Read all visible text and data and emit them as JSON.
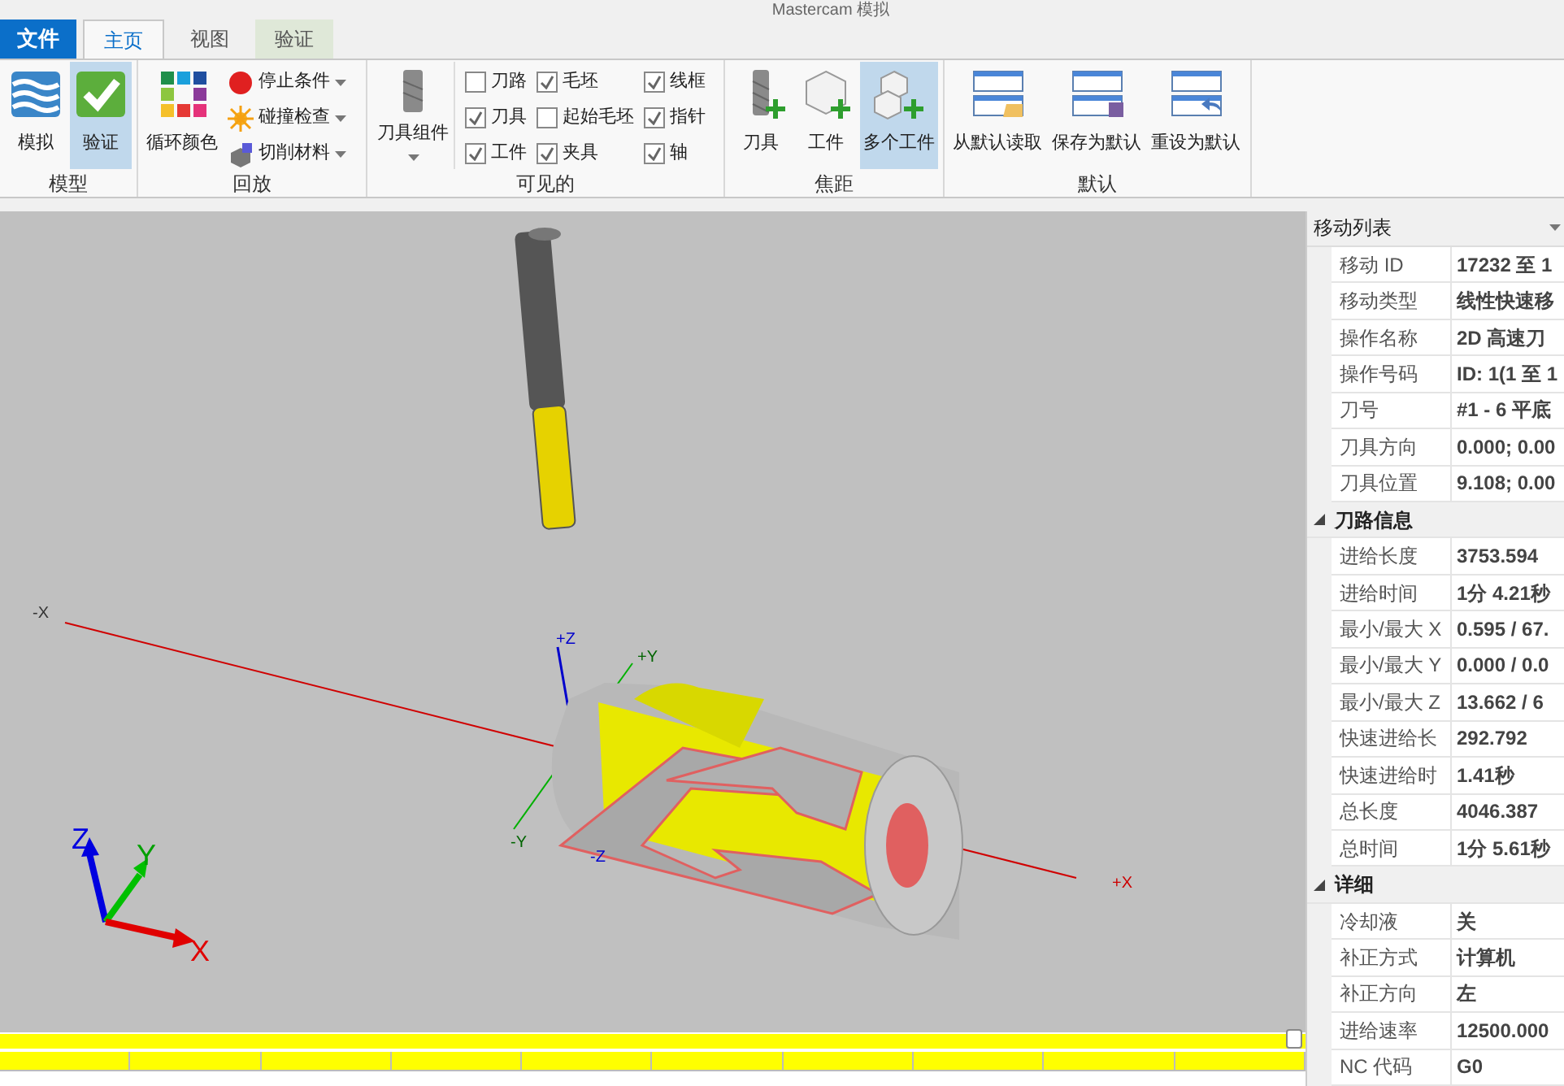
{
  "window": {
    "title": "Mastercam 模拟"
  },
  "file_tab": "文件",
  "tabs": [
    {
      "label": "主页",
      "selected": true,
      "kind": "normal"
    },
    {
      "label": "视图",
      "selected": false,
      "kind": "normal"
    },
    {
      "label": "验证",
      "selected": false,
      "kind": "context"
    }
  ],
  "ribbon_groups": [
    {
      "label": "模型",
      "items": [
        {
          "kind": "large",
          "label": "模拟",
          "selected": false
        },
        {
          "kind": "large",
          "label": "验证",
          "selected": true
        }
      ]
    },
    {
      "label": "回放",
      "items": [
        {
          "kind": "large",
          "label": "循环颜色",
          "selected": false
        },
        {
          "kind": "small",
          "label": "停止条件"
        },
        {
          "kind": "small",
          "label": "碰撞检查"
        },
        {
          "kind": "small",
          "label": "切削材料"
        }
      ]
    },
    {
      "label": "可见的",
      "items": [
        {
          "kind": "dropdown",
          "label": "刀具组件"
        },
        {
          "kind": "check",
          "label": "刀路",
          "checked": false
        },
        {
          "kind": "check",
          "label": "刀具",
          "checked": true
        },
        {
          "kind": "check",
          "label": "工件",
          "checked": true
        },
        {
          "kind": "check",
          "label": "毛坯",
          "checked": true
        },
        {
          "kind": "check",
          "label": "起始毛坯",
          "checked": false
        },
        {
          "kind": "check",
          "label": "夹具",
          "checked": true
        },
        {
          "kind": "check",
          "label": "线框",
          "checked": true
        },
        {
          "kind": "check",
          "label": "指针",
          "checked": true
        },
        {
          "kind": "check",
          "label": "轴",
          "checked": true
        }
      ]
    },
    {
      "label": "焦距",
      "items": [
        {
          "kind": "large",
          "label": "刀具",
          "selected": false
        },
        {
          "kind": "large",
          "label": "工件",
          "selected": false
        },
        {
          "kind": "large",
          "label": "多个工件",
          "selected": true
        }
      ]
    },
    {
      "label": "默认",
      "items": [
        {
          "kind": "large",
          "label": "从默认读取",
          "selected": false
        },
        {
          "kind": "large",
          "label": "保存为默认",
          "selected": false
        },
        {
          "kind": "large",
          "label": "重设为默认",
          "selected": false
        }
      ]
    }
  ],
  "viewport": {
    "axis_labels": [
      "-X",
      "+Z",
      "+Y",
      "-Y",
      "-Z",
      "+X"
    ],
    "triad_labels": [
      "Z",
      "Y",
      "X"
    ],
    "timeline": {
      "level": 1.0
    }
  },
  "properties": {
    "title": "移动列表",
    "rows": [
      [
        "移动 ID",
        "17232 至 1"
      ],
      [
        "移动类型",
        "线性快速移"
      ],
      [
        "操作名称",
        "2D 高速刀"
      ],
      [
        "操作号码",
        "ID: 1(1 至 1"
      ],
      [
        "刀号",
        "#1 - 6 平底"
      ],
      [
        "刀具方向",
        "0.000; 0.00"
      ],
      [
        "刀具位置",
        "9.108; 0.00"
      ]
    ],
    "sections": [
      {
        "label": "刀路信息",
        "expanded": true,
        "rows": [
          [
            "进给长度",
            "3753.594"
          ],
          [
            "进给时间",
            "1分 4.21秒"
          ],
          [
            "最小/最大 X",
            "0.595 / 67."
          ],
          [
            "最小/最大 Y",
            "0.000 / 0.0"
          ],
          [
            "最小/最大 Z",
            "13.662 / 6"
          ],
          [
            "快速进给长",
            "292.792"
          ],
          [
            "快速进给时",
            "1.41秒"
          ],
          [
            "总长度",
            "4046.387"
          ],
          [
            "总时间",
            "1分 5.61秒"
          ]
        ]
      },
      {
        "label": "详细",
        "expanded": true,
        "rows": [
          [
            "冷却液",
            "关"
          ],
          [
            "补正方式",
            "计算机"
          ],
          [
            "补正方向",
            "左"
          ],
          [
            "进给速率",
            "12500.000"
          ],
          [
            "NC 代码",
            "G0"
          ]
        ]
      }
    ]
  }
}
